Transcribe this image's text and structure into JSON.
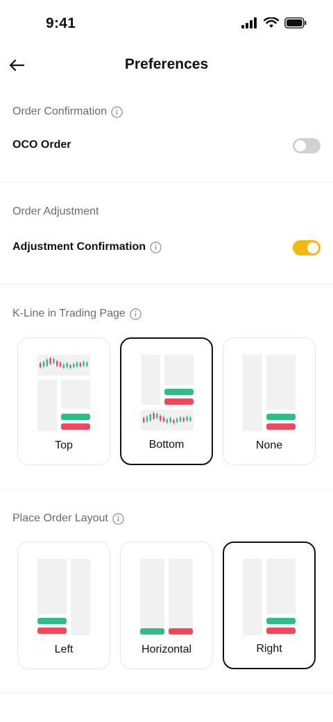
{
  "status_bar": {
    "time": "9:41"
  },
  "header": {
    "title": "Preferences"
  },
  "order_confirmation": {
    "section_title": "Order Confirmation",
    "oco_label": "OCO Order",
    "oco_enabled": false
  },
  "order_adjustment": {
    "section_title": "Order Adjustment",
    "adjustment_label": "Adjustment Confirmation",
    "adjustment_enabled": true
  },
  "kline": {
    "section_title": "K-Line in Trading Page",
    "options": [
      {
        "label": "Top",
        "selected": false
      },
      {
        "label": "Bottom",
        "selected": true
      },
      {
        "label": "None",
        "selected": false
      }
    ]
  },
  "layout": {
    "section_title": "Place Order Layout",
    "options": [
      {
        "label": "Left",
        "selected": false
      },
      {
        "label": "Horizontal",
        "selected": false
      },
      {
        "label": "Right",
        "selected": true
      }
    ]
  },
  "colors": {
    "accent": "#f0b90b",
    "buy": "#2ebd85",
    "sell": "#f0485a"
  }
}
